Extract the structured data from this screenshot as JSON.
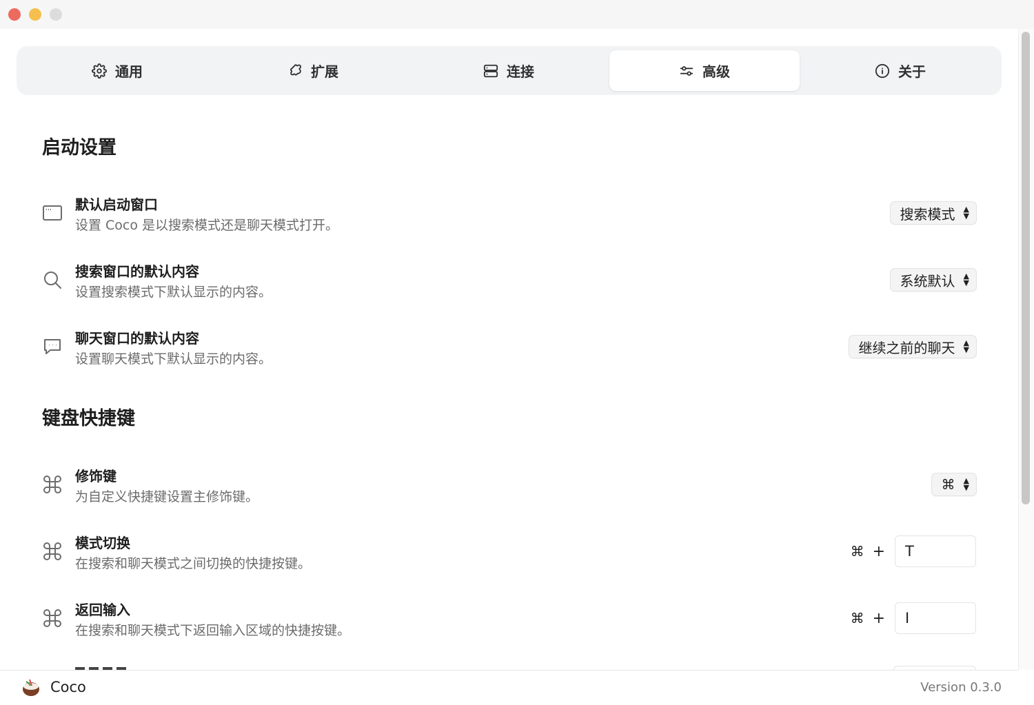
{
  "window": {
    "buttons": [
      "close",
      "minimize",
      "maximize"
    ]
  },
  "tabs": [
    {
      "label": "通用",
      "icon": "gear-icon",
      "active": false
    },
    {
      "label": "扩展",
      "icon": "puzzle-icon",
      "active": false
    },
    {
      "label": "连接",
      "icon": "server-icon",
      "active": false
    },
    {
      "label": "高级",
      "icon": "sliders-icon",
      "active": true
    },
    {
      "label": "关于",
      "icon": "info-icon",
      "active": false
    }
  ],
  "startup": {
    "title": "启动设置",
    "rows": [
      {
        "title": "默认启动窗口",
        "desc": "设置 Coco 是以搜索模式还是聊天模式打开。",
        "icon": "window-icon",
        "value": "搜索模式"
      },
      {
        "title": "搜索窗口的默认内容",
        "desc": "设置搜索模式下默认显示的内容。",
        "icon": "search-icon",
        "value": "系统默认"
      },
      {
        "title": "聊天窗口的默认内容",
        "desc": "设置聊天模式下默认显示的内容。",
        "icon": "chat-icon",
        "value": "继续之前的聊天"
      }
    ]
  },
  "shortcuts": {
    "title": "键盘快捷键",
    "modifier": {
      "title": "修饰键",
      "desc": "为自定义快捷键设置主修饰键。",
      "icon": "command-icon",
      "value": "⌘"
    },
    "rows": [
      {
        "title": "模式切换",
        "desc": "在搜索和聊天模式之间切换的快捷按键。",
        "icon": "command-icon",
        "mod": "⌘",
        "plus": "+",
        "key": "T"
      },
      {
        "title": "返回输入",
        "desc": "在搜索和聊天模式下返回输入区域的快捷按键。",
        "icon": "command-icon",
        "mod": "⌘",
        "plus": "+",
        "key": "I"
      }
    ]
  },
  "footer": {
    "app_name": "Coco",
    "version": "Version 0.3.0"
  }
}
